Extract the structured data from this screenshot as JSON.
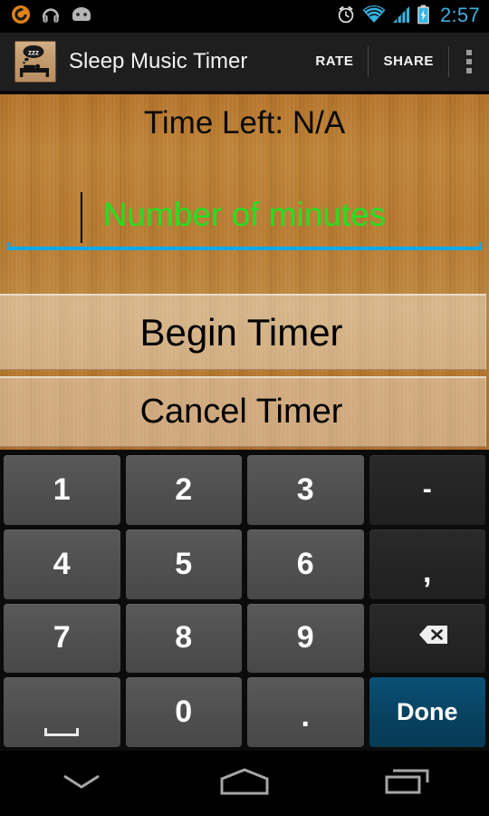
{
  "status_bar": {
    "left_icons": [
      {
        "name": "sync-app-icon",
        "color": "#e08214"
      },
      {
        "name": "headphones-icon",
        "color": "#b5b5b5"
      },
      {
        "name": "android-face-icon",
        "color": "#b5b5b5"
      }
    ],
    "right_icons": [
      {
        "name": "alarm-clock-icon",
        "color": "#e8e8e8"
      },
      {
        "name": "wifi-icon",
        "color": "#33b5e5"
      },
      {
        "name": "cell-signal-icon",
        "color": "#33b5e5"
      },
      {
        "name": "battery-charging-icon",
        "color": "#33b5e5"
      }
    ],
    "clock": "2:57"
  },
  "action_bar": {
    "app_icon_name": "sleep-music-timer-app-icon",
    "title": "Sleep Music Timer",
    "actions": [
      {
        "label": "RATE"
      },
      {
        "label": "SHARE"
      }
    ],
    "overflow_name": "overflow-menu-icon"
  },
  "main": {
    "time_left_label": "Time Left: N/A",
    "minutes_input": {
      "value": "",
      "placeholder": "Number of minutes",
      "placeholder_color": "#22e021",
      "underline_color": "#10a8e8"
    },
    "buttons": {
      "begin": "Begin Timer",
      "cancel": "Cancel Timer"
    }
  },
  "keyboard": {
    "rows": [
      [
        {
          "label": "1",
          "name": "key-1",
          "type": "num"
        },
        {
          "label": "2",
          "name": "key-2",
          "type": "num"
        },
        {
          "label": "3",
          "name": "key-3",
          "type": "num"
        },
        {
          "label": "-",
          "name": "key-minus",
          "type": "fn"
        }
      ],
      [
        {
          "label": "4",
          "name": "key-4",
          "type": "num"
        },
        {
          "label": "5",
          "name": "key-5",
          "type": "num"
        },
        {
          "label": "6",
          "name": "key-6",
          "type": "num"
        },
        {
          "label": ",",
          "name": "key-comma",
          "type": "fn"
        }
      ],
      [
        {
          "label": "7",
          "name": "key-7",
          "type": "num"
        },
        {
          "label": "8",
          "name": "key-8",
          "type": "num"
        },
        {
          "label": "9",
          "name": "key-9",
          "type": "num"
        },
        {
          "label": "",
          "name": "key-backspace",
          "type": "fn",
          "icon": "backspace-icon"
        }
      ],
      [
        {
          "label": "",
          "name": "key-space",
          "type": "num",
          "icon": "space-icon"
        },
        {
          "label": "0",
          "name": "key-0",
          "type": "num"
        },
        {
          "label": ".",
          "name": "key-period",
          "type": "num"
        },
        {
          "label": "Done",
          "name": "key-done",
          "type": "done"
        }
      ]
    ],
    "done_key_color": "#07415f"
  },
  "nav_bar": {
    "buttons": [
      {
        "name": "hide-keyboard-icon"
      },
      {
        "name": "home-icon"
      },
      {
        "name": "recents-icon"
      }
    ]
  }
}
